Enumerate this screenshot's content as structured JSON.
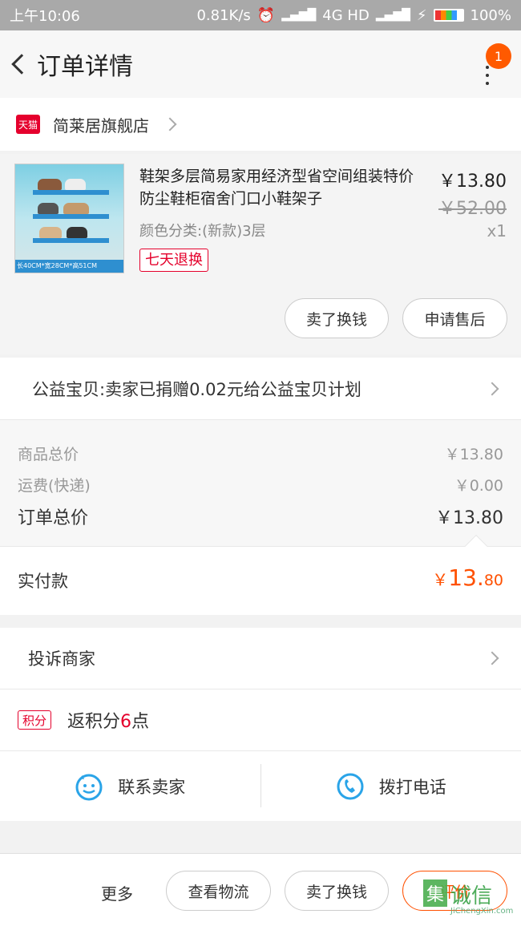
{
  "status_bar": {
    "time": "上午10:06",
    "speed": "0.81K/s",
    "network": "4G HD",
    "battery": "100%"
  },
  "header": {
    "title": "订单详情",
    "notification_count": "1"
  },
  "shop": {
    "badge": "天猫",
    "name": "简莱居旗舰店"
  },
  "product": {
    "name": "鞋架多层简易家用经济型省空间组装特价防尘鞋柜宿舍门口小鞋架子",
    "spec": "颜色分类:(新款)3层",
    "tag": "七天退换",
    "price": "￥13.80",
    "original_price": "￥52.00",
    "quantity": "x1",
    "image_caption": "长40CM*宽28CM*高51CM",
    "buttons": {
      "sell": "卖了换钱",
      "after_sale": "申请售后"
    }
  },
  "charity": {
    "text": "公益宝贝:卖家已捐赠0.02元给公益宝贝计划"
  },
  "summary": {
    "goods_label": "商品总价",
    "goods_value": "￥13.80",
    "shipping_label": "运费(快递)",
    "shipping_value": "￥0.00",
    "total_label": "订单总价",
    "total_value": "￥13.80"
  },
  "payment": {
    "label": "实付款",
    "currency": "￥",
    "integer": "13.",
    "decimal": "80"
  },
  "complaint": {
    "label": "投诉商家"
  },
  "points": {
    "badge": "积分",
    "prefix": "返积分",
    "count": "6",
    "suffix": "点"
  },
  "contact": {
    "seller": "联系卖家",
    "phone": "拨打电话"
  },
  "bottom_bar": {
    "more": "更多",
    "logistics": "查看物流",
    "sell": "卖了换钱",
    "review": "评价"
  },
  "watermark": {
    "glyph": "集",
    "text": "诚信",
    "url": "JiChengXin.com"
  },
  "colors": {
    "accent": "#ff5000",
    "tmall_red": "#e4002b",
    "icon_blue": "#2aa4e8"
  }
}
